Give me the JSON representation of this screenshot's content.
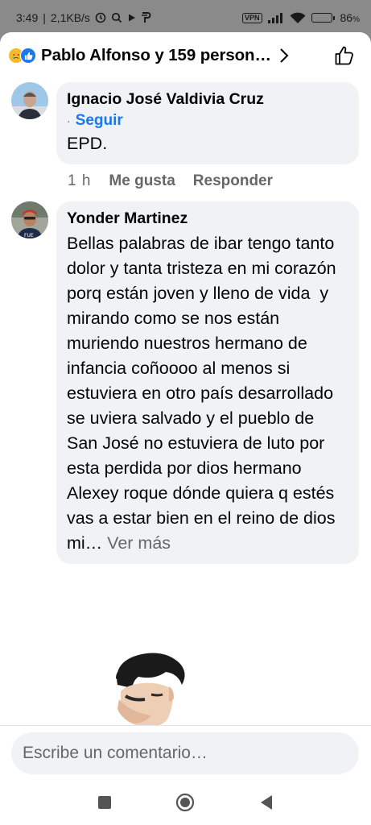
{
  "status_bar": {
    "time": "3:49",
    "net_speed": "2,1KB/s",
    "vpn": "VPN",
    "battery": "86",
    "battery_level": 0.86
  },
  "header": {
    "title": "Pablo Alfonso y 159 person…",
    "reaction_icons": [
      "sad-reaction-icon",
      "like-reaction-icon"
    ]
  },
  "comments": [
    {
      "author": "Ignacio José Valdivia Cruz",
      "follow_label": "Seguir",
      "text": "EPD.",
      "time": "1 h",
      "like_label": "Me gusta",
      "reply_label": "Responder"
    },
    {
      "author": "Yonder Martinez",
      "text": "Bellas palabras de ibar tengo tanto dolor y tanta tristeza en mi corazón porq están joven y lleno de vida  y mirando como se nos están muriendo nuestros hermano de infancia coñoooo al menos si estuviera en otro país desarrollado se uviera salvado y el pueblo de San José no estuviera de luto por esta perdida por dios hermano Alexey roque dónde quiera q estés vas a estar bien en el reino de dios mi…",
      "see_more": " Ver más"
    }
  ],
  "composer": {
    "placeholder": "Escribe un comentario…"
  },
  "colors": {
    "accent": "#1877f2",
    "bubble": "#f0f2f5",
    "muted": "#65676b"
  }
}
